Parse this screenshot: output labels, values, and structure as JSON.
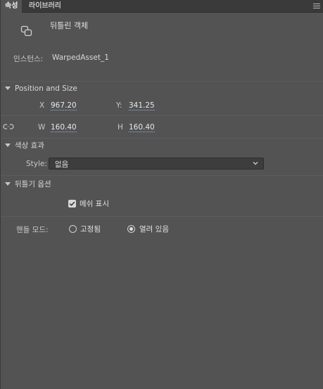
{
  "tabs": [
    {
      "label": "속성",
      "active": true
    },
    {
      "label": "라이브러리",
      "active": false
    }
  ],
  "header": {
    "object_name": "뒤틀린 객체",
    "icon": "warp-object-icon"
  },
  "instance": {
    "label": "인스턴스:",
    "value": "WarpedAsset_1"
  },
  "position_size": {
    "title": "Position and Size",
    "x_label": "X",
    "x_value": "967.20",
    "y_label": "Y:",
    "y_value": "341.25",
    "w_label": "W",
    "w_value": "160.40",
    "h_label": "H",
    "h_value": "160.40",
    "link_icon": "link-icon"
  },
  "color_effect": {
    "title": "색상 효과",
    "style_label": "Style:",
    "style_value": "없음"
  },
  "warp_options": {
    "title": "뒤틀기 옵션",
    "show_mesh_label": "메쉬 표시",
    "show_mesh_checked": true,
    "handle_mode_label": "핸들 모드:",
    "fixed_label": "고정됨",
    "open_label": "열려 있음",
    "selected": "open"
  },
  "colors": {
    "panel_bg": "#535353",
    "tab_bg": "#3a3a3a",
    "accent_underline": "#8fb4e0"
  }
}
